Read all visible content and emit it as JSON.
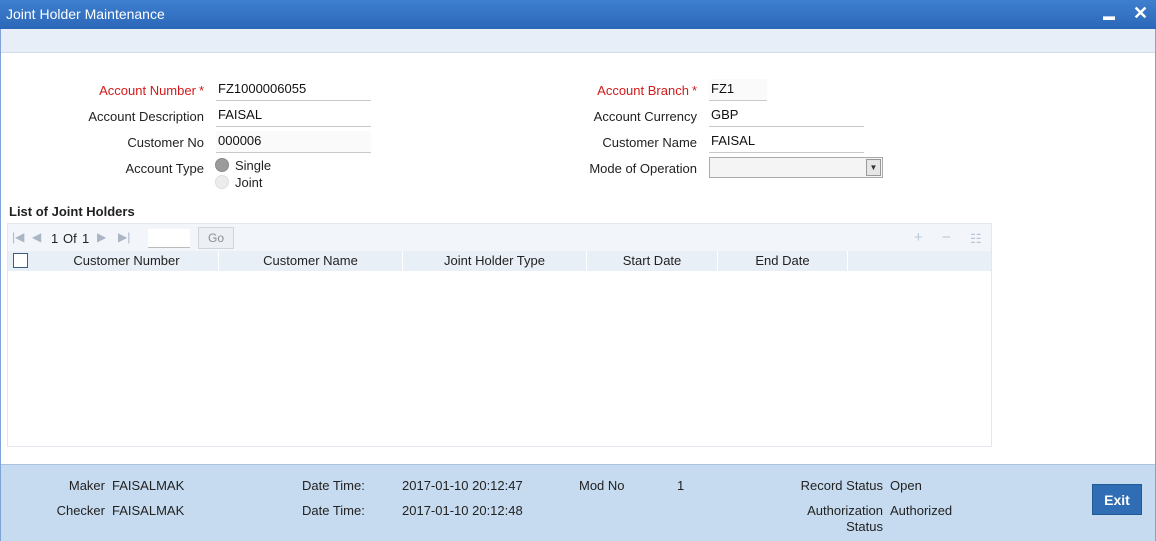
{
  "window": {
    "title": "Joint Holder Maintenance",
    "minimize_glyph": "▬",
    "close_glyph": "✕"
  },
  "form": {
    "account_number": {
      "label": "Account Number",
      "required_mark": "*",
      "value": "FZ1000006055"
    },
    "account_description": {
      "label": "Account Description",
      "value": "FAISAL"
    },
    "customer_no": {
      "label": "Customer No",
      "value": "000006"
    },
    "account_type": {
      "label": "Account Type",
      "options": [
        "Single",
        "Joint"
      ],
      "selected": "Single"
    },
    "account_branch": {
      "label": "Account Branch",
      "required_mark": "*",
      "value": "FZ1"
    },
    "account_currency": {
      "label": "Account Currency",
      "value": "GBP"
    },
    "customer_name": {
      "label": "Customer Name",
      "value": "FAISAL"
    },
    "mode_of_operation": {
      "label": "Mode of Operation",
      "value": ""
    }
  },
  "joint_holders": {
    "title": "List of Joint Holders",
    "pagination": {
      "current": "1",
      "of_label": "Of",
      "total": "1",
      "go_label": "Go"
    },
    "columns": [
      "Customer Number",
      "Customer Name",
      "Joint Holder Type",
      "Start Date",
      "End Date"
    ],
    "rows": []
  },
  "footer": {
    "maker_label": "Maker",
    "maker": "FAISALMAK",
    "checker_label": "Checker",
    "checker": "FAISALMAK",
    "date_time_label": "Date Time:",
    "maker_date_time": "2017-01-10 20:12:47",
    "checker_date_time": "2017-01-10 20:12:48",
    "mod_no_label": "Mod No",
    "mod_no": "1",
    "record_status_label": "Record Status",
    "record_status": "Open",
    "authorization_status_label_1": "Authorization",
    "authorization_status_label_2": "Status",
    "authorization_status": "Authorized",
    "exit_label": "Exit"
  },
  "colors": {
    "titlebar": "#2b67b8",
    "required_label": "#d11a1a",
    "footer_bg": "#c6dbef",
    "exit_button": "#2f6eb4"
  }
}
